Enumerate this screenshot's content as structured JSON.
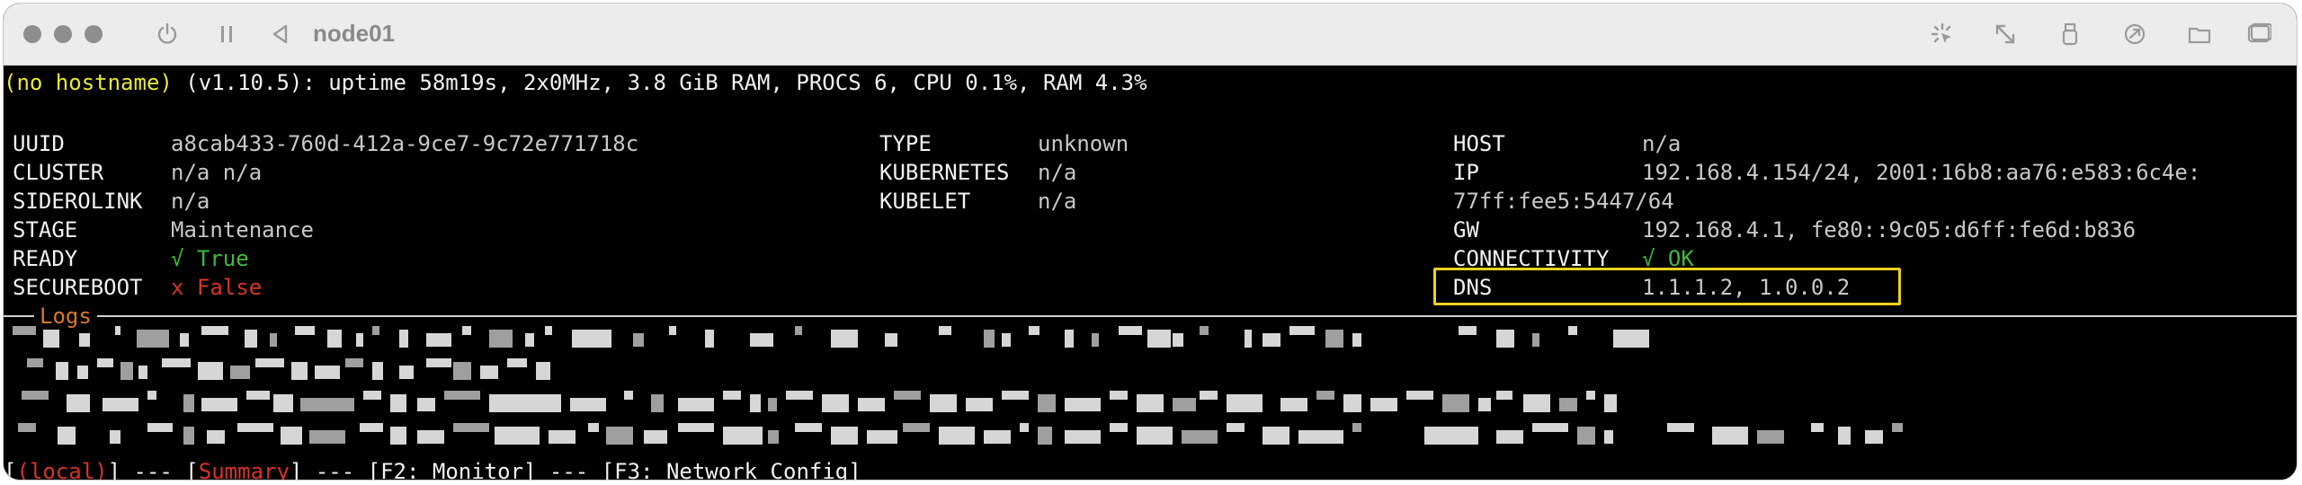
{
  "window": {
    "title": "node01",
    "toolbar_icons": [
      "power-icon",
      "pause-icon",
      "back-icon",
      "pointer-icon",
      "resize-icon",
      "usb-icon",
      "share-icon",
      "folder-icon",
      "display-icon"
    ]
  },
  "status": {
    "hostname": "(no hostname)",
    "rest": " (v1.10.5): uptime 58m19s, 2x0MHz, 3.8 GiB RAM, PROCS 6, CPU 0.1%, RAM 4.3%"
  },
  "info": {
    "uuid_label": "UUID",
    "uuid": "a8cab433-760d-412a-9ce7-9c72e771718c",
    "cluster_label": "CLUSTER",
    "cluster": "n/a n/a",
    "siderolink_label": "SIDEROLINK",
    "siderolink": "n/a",
    "stage_label": "STAGE",
    "stage": "Maintenance",
    "ready_label": "READY",
    "ready": "√ True",
    "secureboot_label": "SECUREBOOT",
    "secureboot": "x False",
    "type_label": "TYPE",
    "type": "unknown",
    "kubernetes_label": "KUBERNETES",
    "kubernetes": "n/a",
    "kubelet_label": "KUBELET",
    "kubelet": "n/a",
    "host_label": "HOST",
    "host": "n/a",
    "ip_label": "IP",
    "ip_line1": "192.168.4.154/24, 2001:16b8:aa76:e583:6c4e:",
    "ip_line2": "77ff:fee5:5447/64",
    "gw_label": "GW",
    "gw": "192.168.4.1, fe80::9c05:d6ff:fe6d:b836",
    "connectivity_label": "CONNECTIVITY",
    "connectivity": "√ OK",
    "dns_label": "DNS",
    "dns": "1.1.1.2, 1.0.0.2"
  },
  "logs": {
    "label": "Logs"
  },
  "footer": {
    "open1": "[",
    "local": "(local)",
    "close1": "]",
    "sep1": " --- [",
    "summary": "Summary",
    "close2": "]",
    "sep2": " --- [F2: Monitor] --- [F3: Network Config]"
  },
  "colors": {
    "yellow": "#e8e839",
    "green": "#3dbb3d",
    "red": "#d8322a",
    "orange": "#d9772b",
    "highlight": "#ebd11f"
  }
}
